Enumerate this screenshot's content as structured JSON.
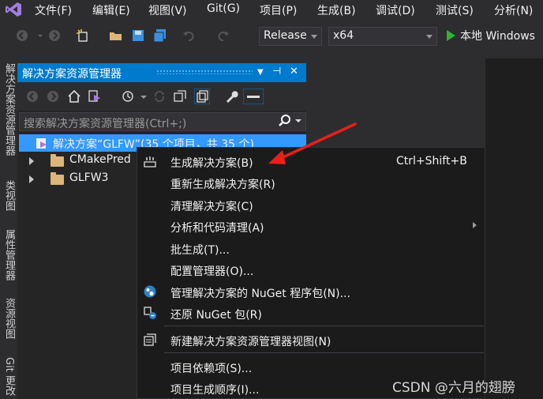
{
  "menubar": {
    "items": [
      "文件(F)",
      "编辑(E)",
      "视图(V)",
      "Git(G)",
      "项目(P)",
      "生成(B)",
      "调试(D)",
      "测试(S)",
      "分析(N)"
    ]
  },
  "toolbar": {
    "configuration": "Release",
    "platform": "x64",
    "start_label": "本地 Windows"
  },
  "side_tabs": [
    "解决方案资源管理器",
    "类视图",
    "属性管理器",
    "资源视图",
    "Git 更改"
  ],
  "solution_explorer": {
    "title": "解决方案资源管理器",
    "search_placeholder": "搜索解决方案资源管理器(Ctrl+;)",
    "tree": {
      "solution": "解决方案“GLFW”(35 个项目，共 35 个)",
      "items": [
        "CMakePred",
        "GLFW3"
      ]
    }
  },
  "context_menu": {
    "items": [
      {
        "label": "生成解决方案(B)",
        "shortcut": "Ctrl+Shift+B"
      },
      {
        "label": "重新生成解决方案(R)"
      },
      {
        "label": "清理解决方案(C)"
      },
      {
        "label": "分析和代码清理(A)"
      },
      {
        "label": "批生成(T)..."
      },
      {
        "label": "配置管理器(O)..."
      },
      {
        "label": "管理解决方案的 NuGet 程序包(N)..."
      },
      {
        "label": "还原 NuGet 包(R)"
      },
      {
        "label": "新建解决方案资源管理器视图(N)"
      },
      {
        "label": "项目依赖项(S)..."
      },
      {
        "label": "项目生成顺序(I)..."
      }
    ]
  },
  "watermark": "CSDN @六月的翅膀",
  "colors": {
    "accent": "#007acc",
    "selection": "#3399ff",
    "annotation_arrow": "#e8201a"
  }
}
